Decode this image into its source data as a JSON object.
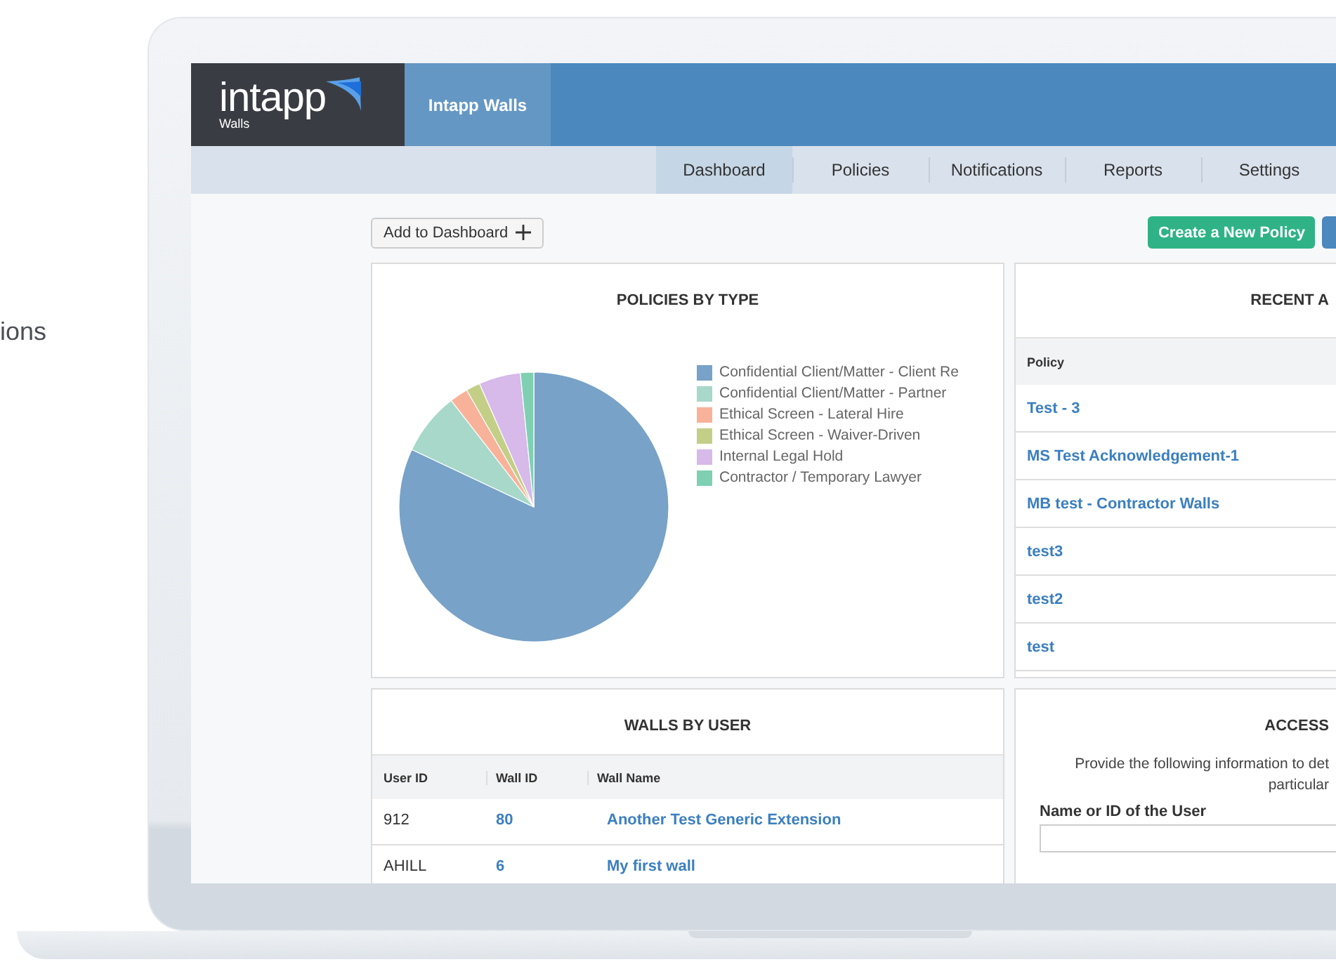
{
  "page_fragment": "ions",
  "app": {
    "wordmark": "intapp",
    "product": "Walls",
    "product_tab": "Intapp Walls"
  },
  "nav_tabs": [
    {
      "label": "Dashboard",
      "selected": true
    },
    {
      "label": "Policies",
      "selected": false
    },
    {
      "label": "Notifications",
      "selected": false
    },
    {
      "label": "Reports",
      "selected": false
    },
    {
      "label": "Settings",
      "selected": false
    }
  ],
  "toolbar": {
    "add_button": "Add to Dashboard",
    "create_button": "Create a New Policy"
  },
  "policies_by_type": {
    "title": "POLICIES BY TYPE",
    "legend": [
      {
        "label": "Confidential Client/Matter - Client Re",
        "color": "#78a2c8"
      },
      {
        "label": "Confidential Client/Matter - Partner",
        "color": "#a7d8c9"
      },
      {
        "label": "Ethical Screen - Lateral Hire",
        "color": "#f9b29a"
      },
      {
        "label": "Ethical Screen - Waiver-Driven",
        "color": "#c3cf87"
      },
      {
        "label": "Internal Legal Hold",
        "color": "#d7b9ea"
      },
      {
        "label": "Contractor / Temporary Lawyer",
        "color": "#7fd0b2"
      }
    ]
  },
  "recent_activity": {
    "title": "RECENT A",
    "columns": [
      "Policy"
    ],
    "rows": [
      "Test - 3",
      "MS Test Acknowledgement-1",
      "MB test - Contractor Walls",
      "test3",
      "test2",
      "test"
    ]
  },
  "walls_by_user": {
    "title": "WALLS BY USER",
    "columns": [
      "User ID",
      "Wall ID",
      "Wall Name"
    ],
    "rows": [
      {
        "user_id": "912",
        "wall_id": "80",
        "wall_name": "Another Test Generic Extension"
      },
      {
        "user_id": "AHILL",
        "wall_id": "6",
        "wall_name": "My first wall"
      }
    ]
  },
  "access": {
    "title": "ACCESS",
    "description": "Provide the following information to det\nparticular",
    "field_label": "Name or ID of the User"
  }
}
